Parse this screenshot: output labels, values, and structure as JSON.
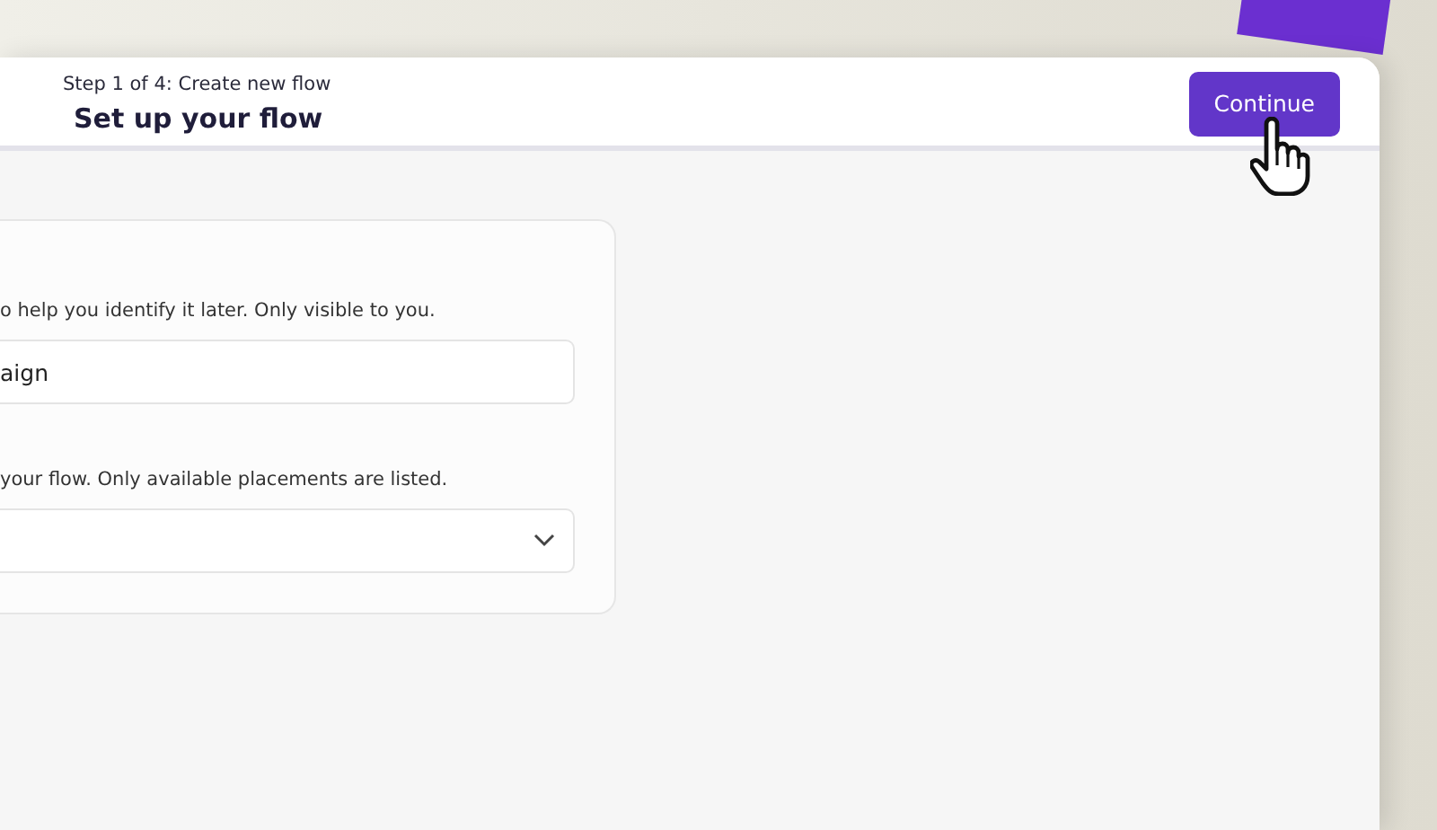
{
  "header": {
    "step": "Step 1 of 4: Create new flow",
    "title": "Set up your flow",
    "button": "Continue"
  },
  "form": {
    "fields": [
      {
        "kind": "text",
        "hint": "o help you identify it later. Only visible to you.",
        "value": "aign"
      },
      {
        "kind": "select",
        "hint": "your flow. Only available placements are listed."
      }
    ]
  }
}
